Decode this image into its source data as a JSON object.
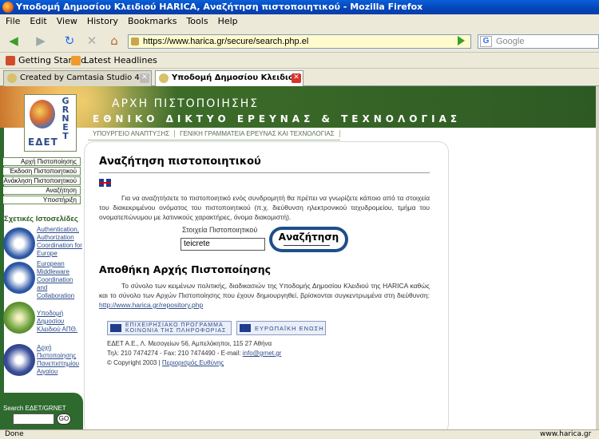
{
  "window": {
    "title": "Υποδομή Δημοσίου Κλειδιού HARICA, Αναζήτηση πιστοποιητικού - Mozilla Firefox"
  },
  "menubar": {
    "items": [
      "File",
      "Edit",
      "View",
      "History",
      "Bookmarks",
      "Tools",
      "Help"
    ]
  },
  "toolbar": {
    "url": "https://www.harica.gr/secure/search.php.el",
    "search_placeholder": "Google",
    "search_engine_label": "G"
  },
  "bookmarks": {
    "items": [
      "Getting Started",
      "Latest Headlines"
    ]
  },
  "tabs": [
    {
      "label": "Created by Camtasia Studio 4"
    },
    {
      "label": "Υποδομή Δημοσίου Κλειδιού HARI..."
    }
  ],
  "site": {
    "banner_title": "ΑΡΧΗ ΠΙΣΤΟΠΟΙΗΣΗΣ",
    "banner_subtitle": "ΕΘΝΙΚΟ ΔΙΚΤΥΟ ΕΡΕΥΝΑΣ & ΤΕΧΝΟΛΟΓΙΑΣ",
    "logo_grnet": "G R N E T",
    "logo_edet": "ΕΔΕΤ",
    "subnav": [
      "ΥΠΟΥΡΓΕΙΟ ΑΝΑΠΤΥΞΗΣ",
      "ΓΕΝΙΚΗ ΓΡΑΜΜΑΤΕΙΑ ΕΡΕΥΝΑΣ ΚΑΙ ΤΕΧΝΟΛΟΓΙΑΣ"
    ],
    "menu": [
      "Αρχή Πιστοποίησης",
      "Έκδοση Πιστοποιητικού",
      "Ανάκληση Πιστοποιητικού",
      "Αναζήτηση Πιστοποιητικού",
      "Υποστήριξη"
    ],
    "related_title": "Σχετικές Ιστοσελίδες",
    "related": [
      "Authentication, Authorization Coordination for Europe",
      "European Middleware Coordination and Collaboration",
      "Υποδομή Δημοσίου Κλειδιού ΑΠΘ.",
      "Αρχή Πιστοποίησης Πανεπιστημίου Αιγαίου"
    ],
    "search_label": "Search ΕΔΕΤ/GRNET",
    "search_go": "GO"
  },
  "content": {
    "title": "Αναζήτηση πιστοποιητικού",
    "intro": "Για να αναζητήσετε το πιστοποιητικό ενός συνδρομητή θα πρέπει να γνωρίζετε κάποιο από τα στοιχεία του διακεκριμένου ονόματος του πιστοποιητικού (π.χ. διεύθυνση ηλεκτρονικού ταχυδρομείου, τμήμα του ονοματεπώνυμου με λατινικούς χαρακτήρες, όνομα διακομιστή).",
    "field_label": "Στοιχεία Πιστοποιητικού",
    "field_value": "teicrete",
    "search_button": "Αναζήτηση",
    "repo_title": "Αποθήκη Αρχής Πιστοποίησης",
    "repo_text": "Το σύνολο των κειμένων πολιτικής, διαδικασιών της Υποδομής Δημοσίου Κλειδιού της HARICA καθώς και το σύνολο των Αρχών Πιστοποίησης που έχουν δημιουργηθεί, βρίσκονται συγκεντρωμένα στη διεύθυνση:",
    "repo_link": "http://www.harica.gr/repository.php",
    "eu_program_1": "ΕΠΙΧΕΙΡΗΣΙΑΚΟ ΠΡΟΓΡΑΜΜΑ",
    "eu_program_2": "ΚΟΙΝΩΝΙΑ ΤΗΣ ΠΛΗΡΟΦΟΡΙΑΣ",
    "eu_union": "ΕΥΡΩΠΑΪΚΗ ΕΝΩΣΗ",
    "address": "ΕΔΕΤ Α.Ε., Λ. Μεσογείων 56, Αμπελόκηποι, 115 27 Αθήνα",
    "phones": "Τηλ: 210 7474274 - Fax: 210 7474490 - E-mail:",
    "email": "info@grnet.gr",
    "copyright": "© Copyright 2003 |",
    "terms": "Περιορισμός Ευθύνης"
  },
  "status": {
    "left": "Done",
    "right": "www.harica.gr"
  }
}
